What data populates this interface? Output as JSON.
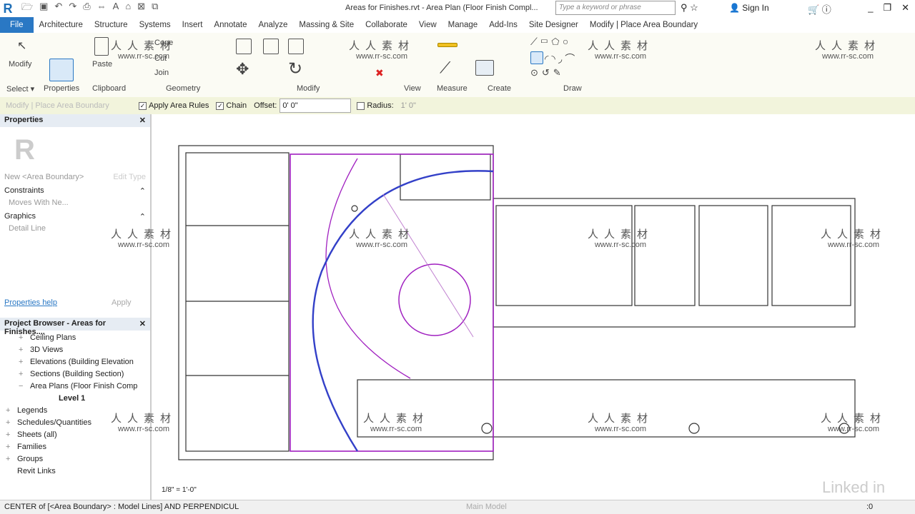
{
  "app": {
    "title": "Areas for Finishes.rvt - Area Plan (Floor Finish Compl...",
    "search_placeholder": "Type a keyword or phrase",
    "sign_in": "Sign In"
  },
  "tabs": [
    "File",
    "Architecture",
    "Structure",
    "Systems",
    "Insert",
    "Annotate",
    "Analyze",
    "Massing & Site",
    "Collaborate",
    "View",
    "Manage",
    "Add-Ins",
    "Site Designer",
    "Modify | Place Area Boundary"
  ],
  "ribbon": {
    "modify": "Modify",
    "select": "Select ▾",
    "properties": "Properties",
    "paste": "Paste",
    "cope": "Cope",
    "cut": "Cut",
    "join": "Join",
    "panels": [
      "Clipboard",
      "Geometry",
      "Modify",
      "View",
      "Measure",
      "Create",
      "Draw"
    ]
  },
  "options": {
    "context": "Modify | Place Area Boundary",
    "apply_area_rules": "Apply Area Rules",
    "apply_area_rules_checked": true,
    "chain": "Chain",
    "chain_checked": true,
    "offset_label": "Offset:",
    "offset_value": "0' 0\"",
    "radius": "Radius:",
    "radius_checked": false,
    "radius_value": "1' 0\""
  },
  "properties": {
    "title": "Properties",
    "type_selector": "New <Area Boundary>",
    "edit_type": "Edit Type",
    "sections": [
      {
        "name": "Constraints",
        "rows": [
          "Moves With Ne..."
        ]
      },
      {
        "name": "Graphics",
        "rows": [
          "Detail Line"
        ]
      }
    ],
    "help": "Properties help",
    "apply": "Apply"
  },
  "browser": {
    "title": "Project Browser - Areas for Finishes....",
    "items": [
      {
        "label": "Ceiling Plans",
        "exp": "+",
        "sub": true
      },
      {
        "label": "3D Views",
        "exp": "+",
        "sub": true
      },
      {
        "label": "Elevations (Building Elevation",
        "exp": "+",
        "sub": true
      },
      {
        "label": "Sections (Building Section)",
        "exp": "+",
        "sub": true
      },
      {
        "label": "Area Plans (Floor Finish Comp",
        "exp": "−",
        "sub": true
      },
      {
        "label": "Level 1",
        "exp": "",
        "bold": true
      },
      {
        "label": "Legends",
        "exp": "+"
      },
      {
        "label": "Schedules/Quantities",
        "exp": "+"
      },
      {
        "label": "Sheets (all)",
        "exp": "+"
      },
      {
        "label": "Families",
        "exp": "+"
      },
      {
        "label": "Groups",
        "exp": "+"
      },
      {
        "label": "Revit Links",
        "exp": ""
      }
    ]
  },
  "view": {
    "scale": "1/8\" = 1'-0\""
  },
  "status": {
    "text": "CENTER  of [<Area Boundary> : Model Lines] AND PERPENDICUL",
    "model": "Main Model",
    "count": ":0"
  },
  "watermark": {
    "cn": "人人素材",
    "url": "www.rr-sc.com",
    "brand": "Linked in"
  },
  "colors": {
    "accent": "#2a78c4",
    "area_boundary": "#a020c0",
    "sketch_line": "#3340c8"
  }
}
